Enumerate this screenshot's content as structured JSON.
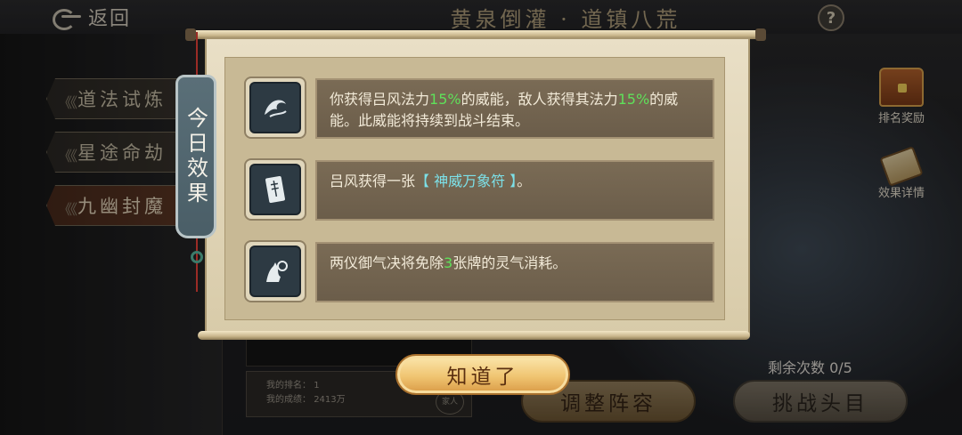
{
  "header": {
    "back_label": "返回",
    "title": "黄泉倒灌 · 道镇八荒",
    "help_symbol": "?"
  },
  "sidebar": {
    "tabs": [
      {
        "label": "道法试炼",
        "arrows": "《《"
      },
      {
        "label": "星途命劫",
        "arrows": "《《"
      },
      {
        "label": "九幽封魔",
        "arrows": "《《"
      }
    ]
  },
  "right_panel": {
    "rank_reward_label": "排名奖励",
    "effect_detail_label": "效果详情",
    "remaining_label": "剩余次数 0/5"
  },
  "bottom": {
    "my_rank_label": "我的排名：",
    "my_rank_value": "1",
    "my_score_label": "我的成绩：",
    "my_score_value": "2413万",
    "seal_text": "家人",
    "adjust_button": "调整阵容",
    "challenge_button": "挑战头目"
  },
  "modal": {
    "tag_label": "今日效果",
    "effects": [
      {
        "icon": "dragon-power-icon",
        "parts": [
          "你获得吕风法力",
          "15%",
          "的威能，敌人获得其法力",
          "15%",
          "的威能。此威能将持续到战斗结束。"
        ]
      },
      {
        "icon": "talisman-card-icon",
        "parts": [
          "吕风获得一张",
          "【 神威万象符 】",
          "。"
        ]
      },
      {
        "icon": "hand-seal-icon",
        "parts": [
          "两仪御气决将免除",
          "3",
          "张牌的灵气消耗。"
        ]
      }
    ],
    "confirm_button": "知道了"
  },
  "colors": {
    "highlight_green": "#5fe05a",
    "highlight_cyan": "#7ce0e8",
    "confirm_gold": "#f0c572"
  }
}
